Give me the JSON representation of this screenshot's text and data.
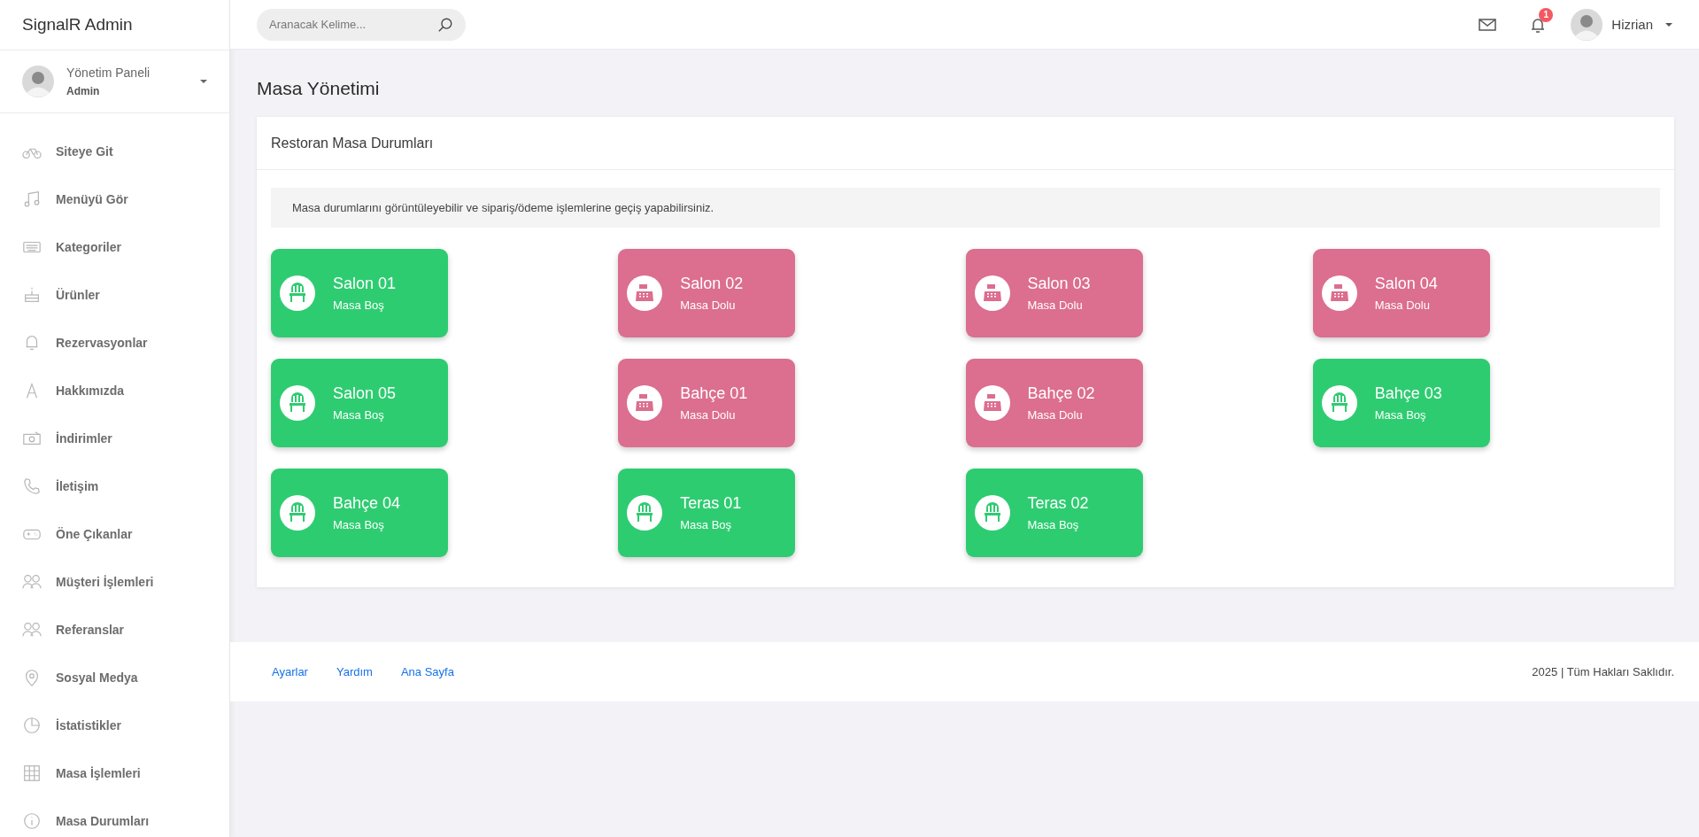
{
  "brand": "SignalR Admin",
  "profile": {
    "title": "Yönetim Paneli",
    "role": "Admin"
  },
  "sidebar": {
    "items": [
      {
        "label": "Siteye Git"
      },
      {
        "label": "Menüyü Gör"
      },
      {
        "label": "Kategoriler"
      },
      {
        "label": "Ürünler"
      },
      {
        "label": "Rezervasyonlar"
      },
      {
        "label": "Hakkımızda"
      },
      {
        "label": "İndirimler"
      },
      {
        "label": "İletişim"
      },
      {
        "label": "Öne Çıkanlar"
      },
      {
        "label": "Müşteri İşlemleri"
      },
      {
        "label": "Referanslar"
      },
      {
        "label": "Sosyal Medya"
      },
      {
        "label": "İstatistikler"
      },
      {
        "label": "Masa İşlemleri"
      },
      {
        "label": "Masa Durumları"
      }
    ]
  },
  "topbar": {
    "search": {
      "placeholder": "Aranacak Kelime..."
    },
    "notification_count": "1",
    "user": "Hizrian"
  },
  "page_title": "Masa Yönetimi",
  "panel": {
    "title": "Restoran Masa Durumları",
    "info": "Masa durumlarını görüntüleyebilir ve sipariş/ödeme işlemlerine geçiş yapabilirsiniz.",
    "tables": [
      {
        "name": "Salon 01",
        "status": "Masa Boş",
        "kind": "free"
      },
      {
        "name": "Salon 02",
        "status": "Masa Dolu",
        "kind": "occupied"
      },
      {
        "name": "Salon 03",
        "status": "Masa Dolu",
        "kind": "occupied"
      },
      {
        "name": "Salon 04",
        "status": "Masa Dolu",
        "kind": "occupied"
      },
      {
        "name": "Salon 05",
        "status": "Masa Boş",
        "kind": "free"
      },
      {
        "name": "Bahçe 01",
        "status": "Masa Dolu",
        "kind": "occupied"
      },
      {
        "name": "Bahçe 02",
        "status": "Masa Dolu",
        "kind": "occupied"
      },
      {
        "name": "Bahçe 03",
        "status": "Masa Boş",
        "kind": "free"
      },
      {
        "name": "Bahçe 04",
        "status": "Masa Boş",
        "kind": "free"
      },
      {
        "name": "Teras 01",
        "status": "Masa Boş",
        "kind": "free"
      },
      {
        "name": "Teras 02",
        "status": "Masa Boş",
        "kind": "free"
      }
    ]
  },
  "footer": {
    "links": [
      "Ayarlar",
      "Yardım",
      "Ana Sayfa"
    ],
    "copyright": "2025 | Tüm Hakları Saklıdır."
  }
}
